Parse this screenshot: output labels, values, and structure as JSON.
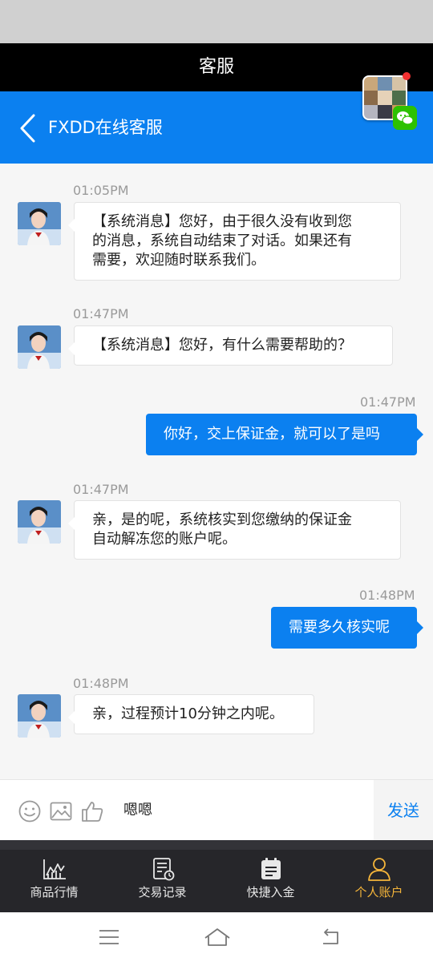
{
  "window": {
    "title": "客服"
  },
  "header": {
    "title": "FXDD在线客服"
  },
  "messages": [
    {
      "time": "01:05PM",
      "lines": [
        "【系统消息】您好，由于很久没有收到您",
        "的消息，系统自动结束了对话。如果还有",
        "需要，欢迎随时联系我们。"
      ]
    },
    {
      "time": "01:47PM",
      "lines": [
        "【系统消息】您好，有什么需要帮助的？"
      ]
    },
    {
      "time": "01:47PM",
      "text": "你好，交上保证金，就可以了是吗"
    },
    {
      "time": "01:47PM",
      "lines": [
        "亲，是的呢，系统核实到您缴纳的保证金",
        "自动解冻您的账户呢。"
      ]
    },
    {
      "time": "01:48PM",
      "text": "需要多久核实呢"
    },
    {
      "time": "01:48PM",
      "lines": [
        "亲，过程预计10分钟之内呢。"
      ]
    }
  ],
  "input": {
    "value": "嗯嗯",
    "send_label": "发送"
  },
  "tabs": [
    {
      "label": "商品行情",
      "icon": "chart-icon"
    },
    {
      "label": "交易记录",
      "icon": "record-icon"
    },
    {
      "label": "快捷入金",
      "icon": "calendar-icon"
    },
    {
      "label": "个人账户",
      "icon": "user-icon"
    }
  ],
  "colors": {
    "primary": "#0b80f0",
    "tab_active": "#f5b53a",
    "tabbar_bg": "#26262a"
  }
}
